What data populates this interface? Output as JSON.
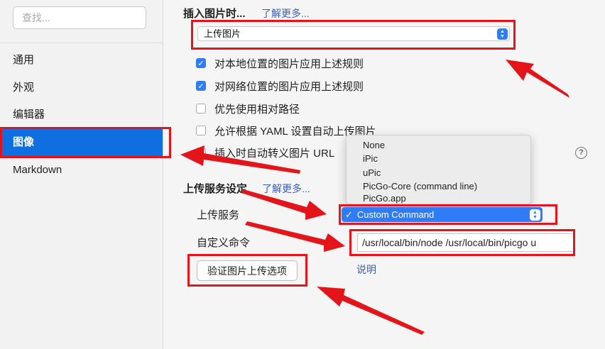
{
  "sidebar": {
    "search_placeholder": "查找...",
    "items": [
      {
        "label": "通用"
      },
      {
        "label": "外观"
      },
      {
        "label": "编辑器"
      },
      {
        "label": "图像"
      },
      {
        "label": "Markdown"
      }
    ]
  },
  "insert": {
    "title": "插入图片时...",
    "learn_more": "了解更多...",
    "select_value": "上传图片",
    "options": [
      {
        "label": "对本地位置的图片应用上述规则",
        "checked": true
      },
      {
        "label": "对网络位置的图片应用上述规则",
        "checked": true
      },
      {
        "label": "优先使用相对路径",
        "checked": false
      },
      {
        "label": "允许根据 YAML 设置自动上传图片",
        "checked": false
      },
      {
        "label": "插入时自动转义图片 URL",
        "checked": false
      }
    ]
  },
  "upload": {
    "title": "上传服务设定",
    "learn_more": "了解更多...",
    "service_label": "上传服务",
    "service_options": [
      "None",
      "iPic",
      "uPic",
      "PicGo-Core (command line)",
      "PicGo.app",
      "Custom Command"
    ],
    "service_selected": "Custom Command",
    "command_label": "自定义命令",
    "command_value": "/usr/local/bin/node /usr/local/bin/picgo u",
    "verify_button": "验证图片上传选项",
    "explain_link": "说明"
  },
  "icons": {
    "help": "help-circle-icon",
    "check": "checkmark-icon",
    "stepper": "select-stepper-icon"
  },
  "colors": {
    "accent": "#2f7cf6",
    "sidebar_active": "#0f6fe0",
    "annotation_red": "#e3151b",
    "link": "#3a5fb8"
  }
}
